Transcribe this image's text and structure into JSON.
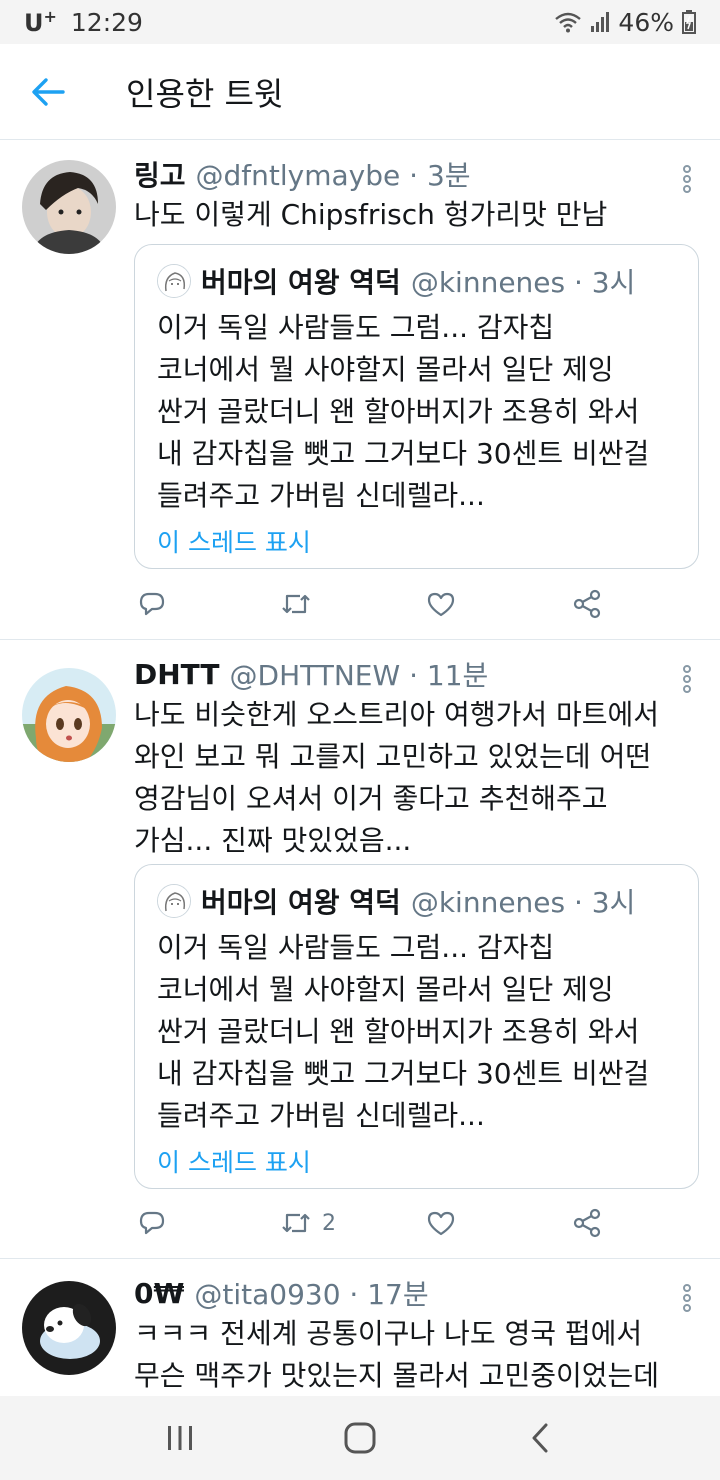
{
  "status_bar": {
    "carrier": "U",
    "carrier_sup": "+",
    "time": "12:29",
    "battery": "46%"
  },
  "app_bar": {
    "title": "인용한 트윗"
  },
  "tweets": [
    {
      "name": "링고",
      "handle": "@dfntlymaybe · 3분",
      "text": "나도 이렇게 Chipsfrisch 헝가리맛 만남",
      "quote": {
        "name": "버마의 여왕 역덕",
        "handle": "@kinnenes · 3시",
        "text_lines": [
          "이거 독일 사람들도 그럼... 감자칩",
          "코너에서 뭘 사야할지 몰라서 일단 제잉",
          "싼거 골랐더니 왠 할아버지가 조용히 와서",
          "내 감자칩을 뺏고 그거보다 30센트 비싼걸",
          "들려주고 가버림 신데렐라..."
        ],
        "thread_link": "이 스레드 표시"
      },
      "retweet_count": ""
    },
    {
      "name": "DHTT",
      "handle": "@DHTTNEW · 11분",
      "text_lines": [
        "나도 비슷한게 오스트리아 여행가서 마트에서",
        "와인 보고 뭐 고를지 고민하고 있었는데 어떤",
        "영감님이 오셔서 이거 좋다고 추천해주고",
        "가심... 진짜 맛있었음..."
      ],
      "quote": {
        "name": "버마의 여왕 역덕",
        "handle": "@kinnenes · 3시",
        "text_lines": [
          "이거 독일 사람들도 그럼... 감자칩",
          "코너에서 뭘 사야할지 몰라서 일단 제잉",
          "싼거 골랐더니 왠 할아버지가 조용히 와서",
          "내 감자칩을 뺏고 그거보다 30센트 비싼걸",
          "들려주고 가버림 신데렐라..."
        ],
        "thread_link": "이 스레드 표시"
      },
      "retweet_count": "2"
    },
    {
      "name": "0₩",
      "handle": "@tita0930 · 17분",
      "text_lines": [
        "ㅋㅋㅋ 전세계 공통이구나 나도 영국 펍에서",
        "무슨 맥주가 맛있는지 몰라서 고민중이었는데"
      ]
    }
  ],
  "colors": {
    "accent": "#1da1f2",
    "text": "#14171a",
    "secondary": "#657786",
    "divider": "#e1e8ed"
  },
  "icons": {
    "back": "arrow-left-icon",
    "reply": "reply-icon",
    "retweet": "retweet-icon",
    "like": "heart-icon",
    "share": "share-icon",
    "more": "more-vertical-icon",
    "nav_recent": "recent-apps-icon",
    "nav_home": "home-icon",
    "nav_back": "nav-back-icon"
  }
}
